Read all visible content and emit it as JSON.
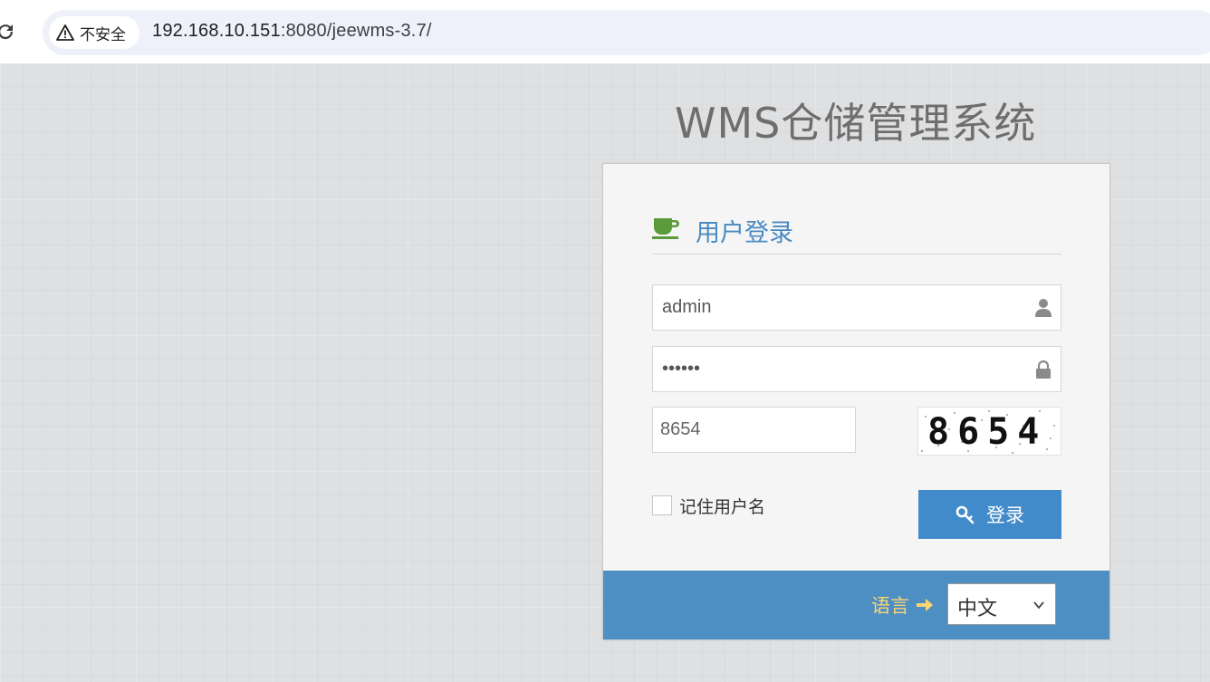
{
  "browser": {
    "security_label": "不安全",
    "url_host": "192.168.10.151",
    "url_path": ":8080/jeewms-3.7/"
  },
  "page": {
    "app_title": "WMS仓储管理系统"
  },
  "login": {
    "title": "用户登录",
    "username_value": "admin",
    "password_value": "••••••",
    "captcha_value": "8654",
    "captcha_image_text": "8654",
    "remember_label": "记住用户名",
    "remember_checked": false,
    "login_button_label": "登录"
  },
  "footer": {
    "language_label": "语言",
    "language_selected": "中文"
  },
  "colors": {
    "title_blue": "#4a8ac2",
    "button_blue": "#428bca",
    "footer_blue": "#4e8fc3",
    "language_label_yellow": "#fcd573",
    "cup_green": "#5b9a3a"
  }
}
